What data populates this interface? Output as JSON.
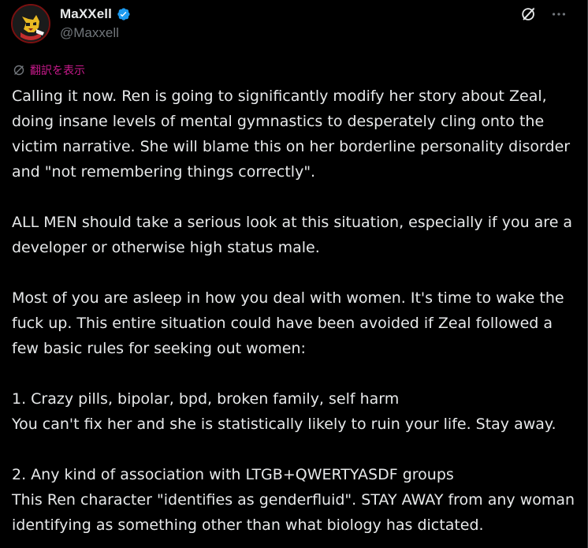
{
  "author": {
    "display_name": "MaXXell",
    "handle": "@Maxxell",
    "verified": true,
    "verified_color": "#1d9bf0"
  },
  "actions": {
    "grok_icon": "grok-slash-icon",
    "more_icon": "more-dots-icon"
  },
  "translate": {
    "label": "翻訳を表示",
    "color": "#c91a8c",
    "icon": "globe-slash-icon"
  },
  "tweet": {
    "paragraphs": [
      "Calling it now. Ren is going to significantly modify her story about Zeal, doing insane levels of mental gymnastics to desperately cling onto the victim narrative. She will blame this on her borderline personality disorder and \"not remembering things correctly\".",
      "ALL MEN should take a serious look at this situation, especially if you are a developer or otherwise high status male.",
      "Most of you are asleep in how you deal with women. It's time to wake the fuck up. This entire situation could have been avoided if Zeal followed a few basic rules for seeking out women:",
      "1. Crazy pills, bipolar, bpd, broken family, self harm\nYou can't fix her and she is statistically likely to ruin your life. Stay away.",
      "2. Any kind of association with LTGB+QWERTYASDF groups\nThis Ren character \"identifies as genderfluid\". STAY AWAY from any woman identifying as something other than what biology has dictated."
    ]
  },
  "colors": {
    "background": "#000000",
    "text": "#e7e9ea",
    "secondary_text": "#71767b"
  }
}
